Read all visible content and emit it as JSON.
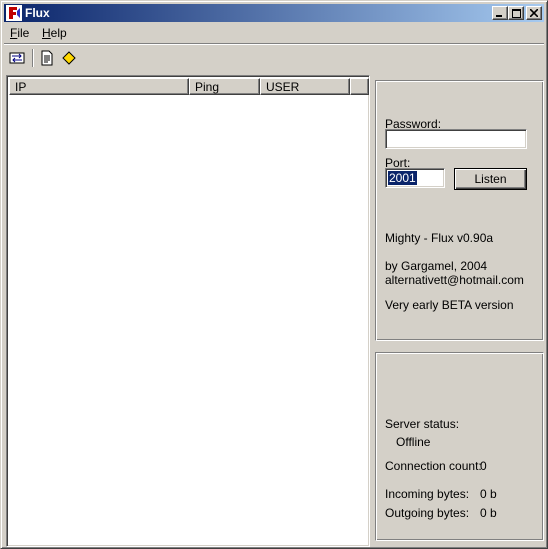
{
  "window": {
    "title": "Flux"
  },
  "menu": {
    "file": "File",
    "file_key": "F",
    "file_rest": "ile",
    "help_key": "H",
    "help_rest": "elp"
  },
  "toolbar": {
    "icons": [
      "connect-icon",
      "document-icon",
      "diamond-icon"
    ],
    "diamond_color": "#ffd800"
  },
  "list": {
    "columns": [
      "IP",
      "Ping",
      "USER"
    ]
  },
  "settings": {
    "password_label": "Password:",
    "password_value": "",
    "port_label": "Port:",
    "port_value": "2001",
    "listen_label": "Listen",
    "about_version": "Mighty - Flux v0.90a",
    "about_author": "by Gargamel, 2004",
    "about_email": "alternativett@hotmail.com",
    "about_note": "Very early BETA version"
  },
  "status": {
    "server_status_label": "Server status:",
    "server_status_value": "Offline",
    "connection_count_label": "Connection count:",
    "connection_count_value": "0",
    "incoming_label": "Incoming bytes:",
    "incoming_value": "0 b",
    "outgoing_label": "Outgoing bytes:",
    "outgoing_value": "0 b"
  },
  "colors": {
    "titlebar_start": "#0a246a",
    "titlebar_end": "#a6caf0",
    "face": "#d4d0c8"
  }
}
